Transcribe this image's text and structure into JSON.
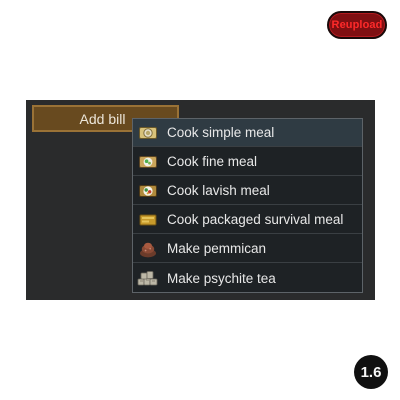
{
  "top": {
    "reupload_label": "Reupload"
  },
  "bills": {
    "add_bill_label": "Add bill",
    "menu_items": [
      {
        "label": "Cook simple meal",
        "icon": "simple-meal-icon"
      },
      {
        "label": "Cook fine meal",
        "icon": "fine-meal-icon"
      },
      {
        "label": "Cook lavish meal",
        "icon": "lavish-meal-icon"
      },
      {
        "label": "Cook packaged survival meal",
        "icon": "packaged-survival-meal-icon"
      },
      {
        "label": "Make pemmican",
        "icon": "pemmican-icon"
      },
      {
        "label": "Make psychite tea",
        "icon": "psychite-tea-icon"
      }
    ]
  },
  "badge": {
    "version": "1.6"
  },
  "colors": {
    "reupload_bg": "#7f0f12",
    "reupload_text": "#ff2a2a",
    "panel_bg": "#2a2b2c",
    "button_bg": "#684a1f",
    "menu_bg": "#1e2225",
    "menu_highlight": "#2f3b43"
  }
}
